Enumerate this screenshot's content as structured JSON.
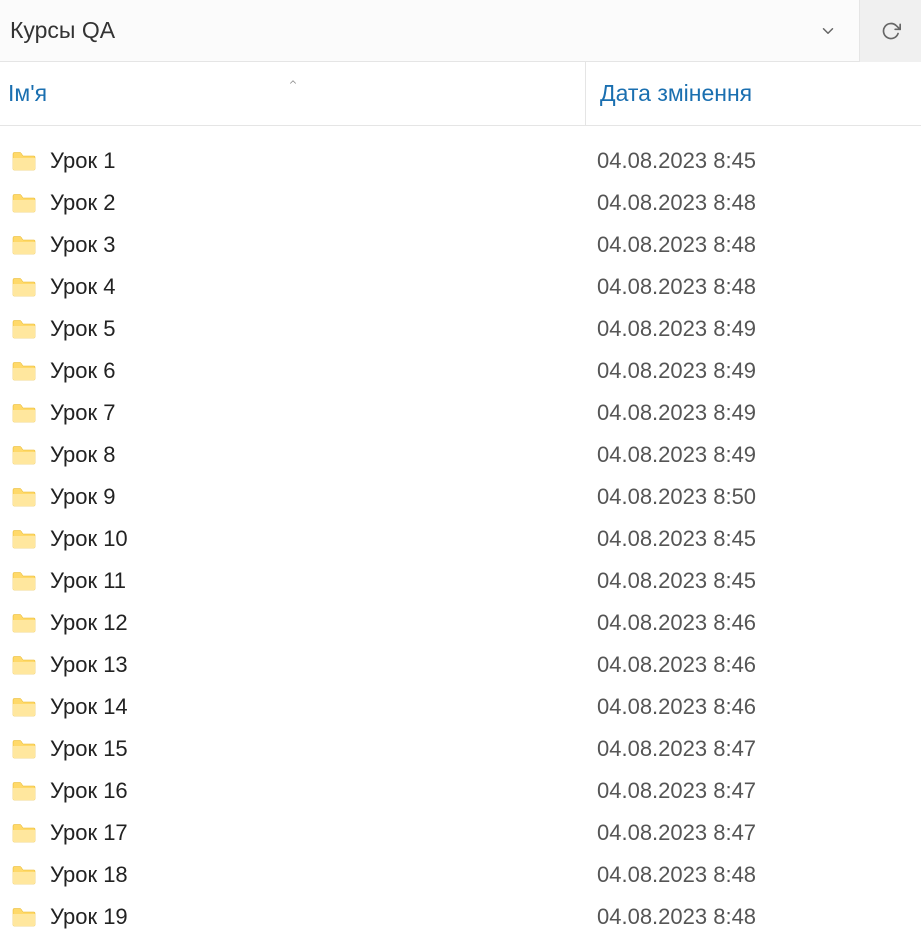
{
  "header": {
    "title": "Курсы QA"
  },
  "columns": {
    "name": "Ім'я",
    "date": "Дата змінення"
  },
  "items": [
    {
      "name": "Урок 1",
      "date": "04.08.2023 8:45"
    },
    {
      "name": "Урок 2",
      "date": "04.08.2023 8:48"
    },
    {
      "name": "Урок 3",
      "date": "04.08.2023 8:48"
    },
    {
      "name": "Урок 4",
      "date": "04.08.2023 8:48"
    },
    {
      "name": "Урок 5",
      "date": "04.08.2023 8:49"
    },
    {
      "name": "Урок 6",
      "date": "04.08.2023 8:49"
    },
    {
      "name": "Урок 7",
      "date": "04.08.2023 8:49"
    },
    {
      "name": "Урок 8",
      "date": "04.08.2023 8:49"
    },
    {
      "name": "Урок 9",
      "date": "04.08.2023 8:50"
    },
    {
      "name": "Урок 10",
      "date": "04.08.2023 8:45"
    },
    {
      "name": "Урок 11",
      "date": "04.08.2023 8:45"
    },
    {
      "name": "Урок 12",
      "date": "04.08.2023 8:46"
    },
    {
      "name": "Урок 13",
      "date": "04.08.2023 8:46"
    },
    {
      "name": "Урок 14",
      "date": "04.08.2023 8:46"
    },
    {
      "name": "Урок 15",
      "date": "04.08.2023 8:47"
    },
    {
      "name": "Урок 16",
      "date": "04.08.2023 8:47"
    },
    {
      "name": "Урок 17",
      "date": "04.08.2023 8:47"
    },
    {
      "name": "Урок 18",
      "date": "04.08.2023 8:48"
    },
    {
      "name": "Урок 19",
      "date": "04.08.2023 8:48"
    }
  ]
}
